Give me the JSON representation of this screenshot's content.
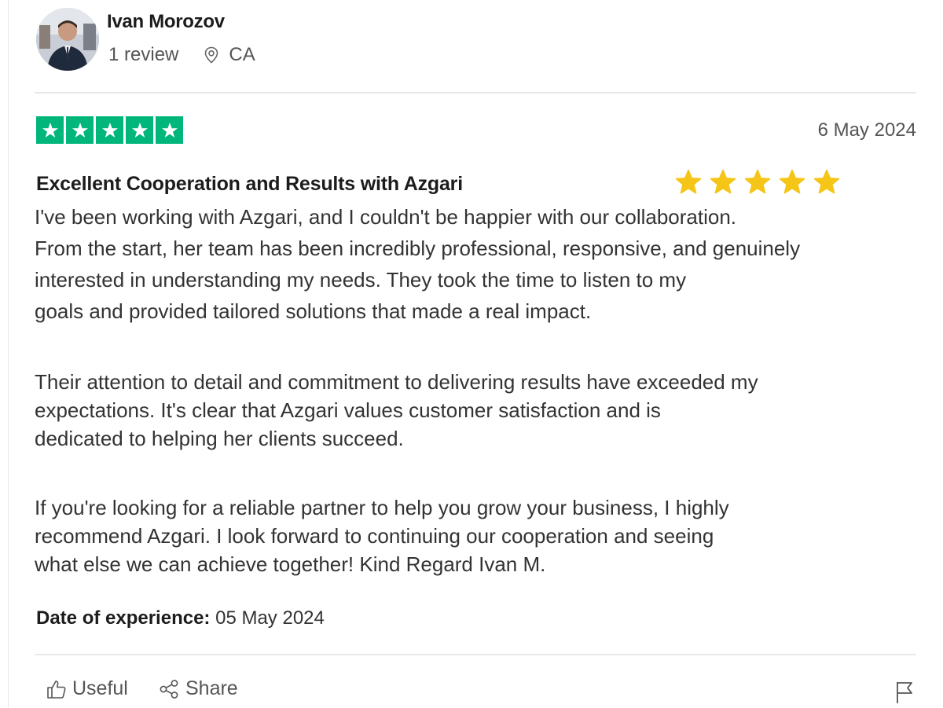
{
  "reviewer": {
    "name": "Ivan Morozov",
    "review_count": "1 review",
    "location": "CA",
    "avatar_icon": "reviewer-photo"
  },
  "review": {
    "rating": 5,
    "rating_max": 5,
    "date": "6 May 2024",
    "title": "Excellent Cooperation and Results with Azgari",
    "decorative_stars": 5,
    "paragraphs": [
      [
        "I've been working with Azgari, and I couldn't be happier with our collaboration.",
        "From the start, her team has been incredibly professional, responsive, and genuinely",
        "interested in understanding my needs. They took the time to listen to my",
        "goals and provided tailored solutions that made a real impact."
      ],
      [
        "Their attention to detail and commitment to delivering results have exceeded my",
        "expectations. It's clear that Azgari values customer satisfaction and is",
        "dedicated to helping her clients succeed."
      ],
      [
        "If you're looking for a reliable partner to help you grow your business, I highly",
        "recommend Azgari. I look forward to continuing our cooperation and seeing",
        "what else we can achieve together! Kind Regard Ivan M."
      ]
    ],
    "experience_label": "Date of experience:",
    "experience_date": "05 May 2024"
  },
  "actions": {
    "useful_label": "Useful",
    "share_label": "Share",
    "useful_icon": "thumbs-up-icon",
    "share_icon": "share-icon",
    "flag_icon": "flag-icon"
  },
  "colors": {
    "trustpilot_green": "#00b67a",
    "gold_star": "#f5c518",
    "text_primary": "#1c1c1c",
    "text_secondary": "#555555"
  }
}
